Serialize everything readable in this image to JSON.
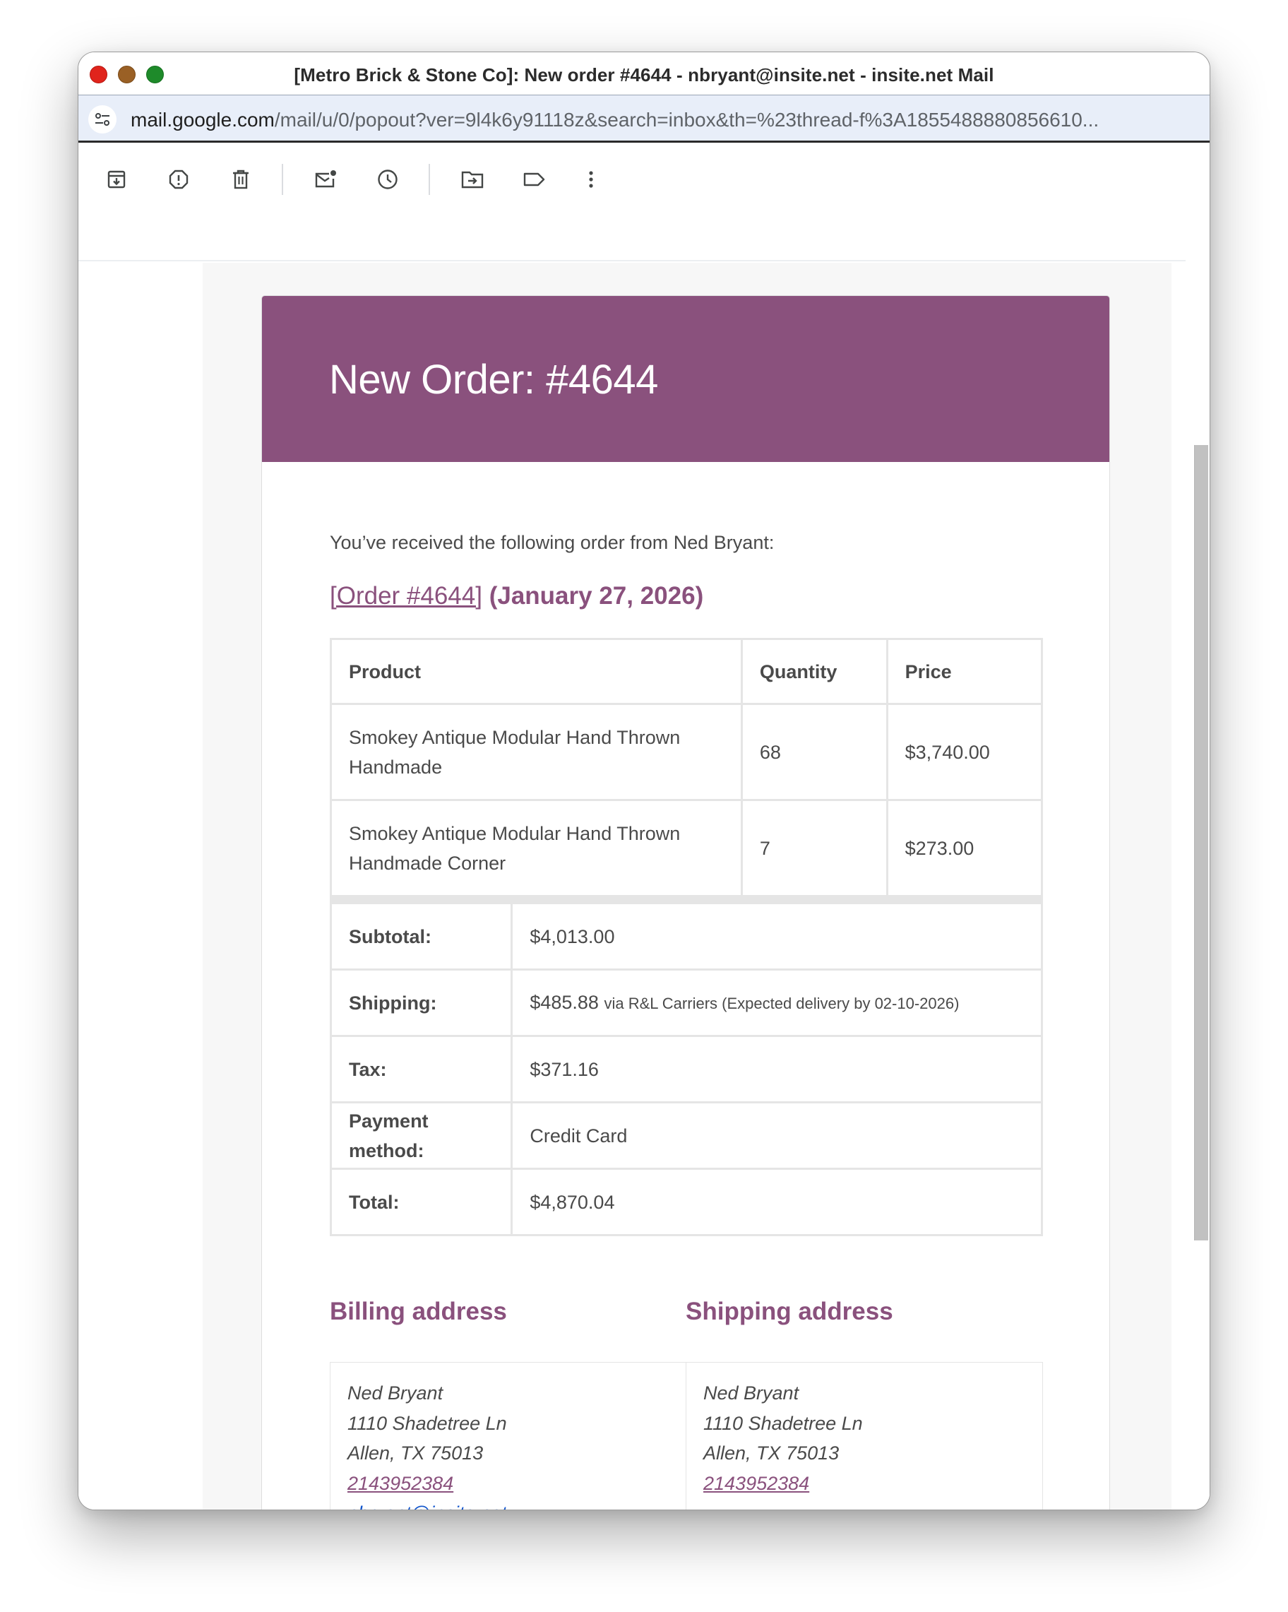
{
  "window": {
    "title": "[Metro Brick & Stone Co]: New order #4644 - nbryant@insite.net - insite.net Mail"
  },
  "urlbar": {
    "domain": "mail.google.com",
    "path": "/mail/u/0/popout?ver=9l4k6y91118z&search=inbox&th=%23thread-f%3A1855488880856610..."
  },
  "toolbar": {
    "icons": [
      "archive-icon",
      "report-spam-icon",
      "delete-icon",
      "mark-unread-icon",
      "snooze-icon",
      "move-to-icon",
      "label-icon",
      "more-icon"
    ]
  },
  "email": {
    "header_title": "New Order: #4644",
    "intro": "You’ve received the following order from Ned Bryant:",
    "order_link": "[Order #4644]",
    "order_date": "(January 27, 2026)",
    "table": {
      "headers": [
        "Product",
        "Quantity",
        "Price"
      ],
      "items": [
        {
          "product": "Smokey Antique Modular Hand Thrown Handmade",
          "quantity": "68",
          "price": "$3,740.00"
        },
        {
          "product": "Smokey Antique Modular Hand Thrown Handmade Corner",
          "quantity": "7",
          "price": "$273.00"
        }
      ],
      "subtotal_label": "Subtotal:",
      "subtotal": "$4,013.00",
      "shipping_label": "Shipping:",
      "shipping": "$485.88",
      "shipping_note": "via R&L Carriers (Expected delivery by 02-10-2026)",
      "tax_label": "Tax:",
      "tax": "$371.16",
      "payment_label": "Payment method:",
      "payment": "Credit Card",
      "total_label": "Total:",
      "total": "$4,870.04"
    },
    "billing": {
      "heading": "Billing address",
      "name": "Ned Bryant",
      "street": "1110 Shadetree Ln",
      "city": "Allen, TX 75013",
      "phone": "2143952384",
      "email": "nbryant@insite.net"
    },
    "shipping_address": {
      "heading": "Shipping address",
      "name": "Ned Bryant",
      "street": "1110 Shadetree Ln",
      "city": "Allen, TX 75013",
      "phone": "2143952384"
    }
  },
  "colors": {
    "brand": "#8a517d",
    "link": "#1155cc",
    "text": "#4a4a4a"
  }
}
